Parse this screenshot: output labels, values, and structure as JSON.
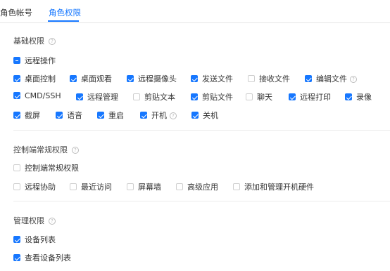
{
  "tabs": [
    {
      "label": "角色帐号",
      "active": false
    },
    {
      "label": "角色权限",
      "active": true
    }
  ],
  "colors": {
    "accent": "#1677ff"
  },
  "sections": [
    {
      "title": "基础权限",
      "master": {
        "label": "远程操作",
        "state": "indeterminate"
      },
      "rows": [
        [
          {
            "label": "桌面控制",
            "checked": true
          },
          {
            "label": "桌面观看",
            "checked": true
          },
          {
            "label": "远程摄像头",
            "checked": true
          },
          {
            "label": "发送文件",
            "checked": true
          },
          {
            "label": "接收文件",
            "checked": false
          },
          {
            "label": "编辑文件",
            "checked": true,
            "help": true
          }
        ],
        [
          {
            "label": "CMD/SSH",
            "checked": true
          },
          {
            "label": "远程管理",
            "checked": true
          },
          {
            "label": "剪贴文本",
            "checked": false
          },
          {
            "label": "剪贴文件",
            "checked": true
          },
          {
            "label": "聊天",
            "checked": false
          },
          {
            "label": "远程打印",
            "checked": true
          },
          {
            "label": "录像",
            "checked": true
          }
        ],
        [
          {
            "label": "截屏",
            "checked": true
          },
          {
            "label": "语音",
            "checked": true
          },
          {
            "label": "重启",
            "checked": true
          },
          {
            "label": "开机",
            "checked": true,
            "help": true
          },
          {
            "label": "关机",
            "checked": true
          }
        ]
      ]
    },
    {
      "title": "控制端常规权限",
      "master": {
        "label": "控制端常规权限",
        "state": "unchecked"
      },
      "rows": [
        [
          {
            "label": "远程协助",
            "checked": false
          },
          {
            "label": "最近访问",
            "checked": false
          },
          {
            "label": "屏幕墙",
            "checked": false
          },
          {
            "label": "高级应用",
            "checked": false
          },
          {
            "label": "添加和管理开机硬件",
            "checked": false
          }
        ]
      ]
    },
    {
      "title": "管理权限",
      "items": [
        {
          "label": "设备列表",
          "checked": true
        },
        {
          "label": "查看设备列表",
          "checked": true
        }
      ]
    }
  ]
}
